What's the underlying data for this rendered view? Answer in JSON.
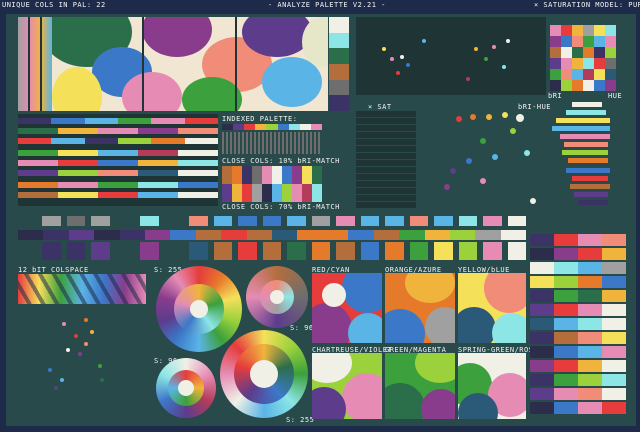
{
  "header": {
    "left": "UNIQUE COLS IN PAL: 22",
    "center": "- ANALYZE PALETTE V2.21 -",
    "right": "× SATURATION MODEL: PURITY"
  },
  "labels": {
    "indexed_palette": "INDEXED PALETTE:",
    "close_cols_1": "CLOSE COLS: 10% bRI-MATCH",
    "close_cols_2": "CLOSE COLS: 70% bRI-MATCH",
    "sat_1": "× SAT",
    "bri_hue": "bRI-HUE",
    "sat_2": "× SAT",
    "bri": "bRI",
    "hue": "HUE",
    "colspace": "12 bIT COLSPACE",
    "s255_top": "S: 255",
    "s96_right": "S: 96",
    "s96_left": "S: 96",
    "s255_bottom": "S: 255",
    "red_cyan": "RED/CYAN",
    "orange_azure": "ORANGE/AZURE",
    "yellow_blue": "YELLOW/bLUE",
    "chartreuse_violet": "CHARTREUSE/VIOLET",
    "green_magenta": "GREEN/MAGENTA",
    "spring_rose": "SPRING-GREEN/ROSE"
  },
  "palette": [
    "#2b2d4a",
    "#3b3366",
    "#5d3c8c",
    "#8a3c8c",
    "#b43c5a",
    "#e63c3c",
    "#e67a2b",
    "#f0b43c",
    "#f5e05a",
    "#9bd23c",
    "#3ca03c",
    "#2b6e4a",
    "#2b5a78",
    "#3c78c8",
    "#5ab4e6",
    "#8ce6e6",
    "#f0f0e6",
    "#a0a0a0",
    "#6e6e6e",
    "#e68cb4",
    "#f08c78",
    "#b46e3c"
  ],
  "colors": {
    "background": "#1e2a4a",
    "panel": "#284a4a",
    "panel_dark": "#1f3535",
    "text": "#f4f4f4"
  }
}
